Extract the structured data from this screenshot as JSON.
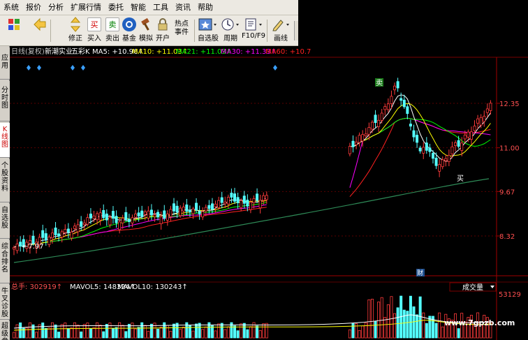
{
  "menu": {
    "items": [
      "系统",
      "报价",
      "分析",
      "扩展行情",
      "委托",
      "智能",
      "工具",
      "资讯",
      "帮助"
    ]
  },
  "toolbar": {
    "buttons": [
      {
        "label": "",
        "icon": "color-grid-icon"
      },
      {
        "label": "",
        "icon": "arrow-left-icon"
      },
      {
        "label": "修正",
        "icon": "arrow-up-down-icon"
      },
      {
        "label": "买入",
        "icon": "buy-icon",
        "glyph": "买"
      },
      {
        "label": "卖出",
        "icon": "sell-icon",
        "glyph": "卖"
      },
      {
        "label": "基金",
        "icon": "fund-icon"
      },
      {
        "label": "模拟",
        "icon": "hammer-icon"
      },
      {
        "label": "开户",
        "icon": "lock-icon"
      },
      {
        "label": "热点\n事件",
        "icon": "hotspot-icon"
      },
      {
        "label": "自选股",
        "icon": "star-icon"
      },
      {
        "label": "周期",
        "icon": "clock-icon"
      },
      {
        "label": "F10/F9",
        "icon": "document-icon"
      },
      {
        "label": "画线",
        "icon": "pencil-icon"
      }
    ]
  },
  "left_tabs": [
    {
      "label": "应用",
      "active": false
    },
    {
      "label": "分时图",
      "active": false
    },
    {
      "label": "K线图",
      "active": true
    },
    {
      "label": "个股资料",
      "active": false
    },
    {
      "label": "自选股",
      "active": false
    },
    {
      "label": "综合排名",
      "active": false
    },
    {
      "label": "牛叉诊股",
      "active": false
    },
    {
      "label": "超级盘",
      "active": false
    }
  ],
  "chart_header": {
    "period": "日线(复权)",
    "stock": "新潮实业",
    "indicator": "五彩K",
    "ma5": "MA5: +10.96↑",
    "ma10": "MA10: +11.03↑",
    "ma21": "MA21: +11.03↑",
    "ma30": "MA30: +11.33↑",
    "ma60": "MA60: +10.7"
  },
  "price_axis": {
    "ticks": [
      "12.35",
      "11.00",
      "9.67",
      "8.32"
    ]
  },
  "annotations": {
    "low_price": "←7.97",
    "sell_marker": "卖",
    "buy_marker": "买",
    "finance_marker": "财"
  },
  "volume_header": {
    "total": "总手: 302919↑",
    "mavol5": "MAVOL5: 148324↑",
    "mavol10": "MAVOL10: 130243↑",
    "dropdown": "成交量",
    "axis_value": "53129"
  },
  "watermark": "www.7gpzb.com",
  "colors": {
    "up": "#ff3b3b",
    "down": "#54ffff",
    "ma5": "#ffffff",
    "ma10": "#ffff00",
    "ma21": "#00ff00",
    "ma30": "#ff00ff",
    "ma60": "#ff2020",
    "long_ma": "#2e8b57",
    "axis": "#8b0000"
  }
}
